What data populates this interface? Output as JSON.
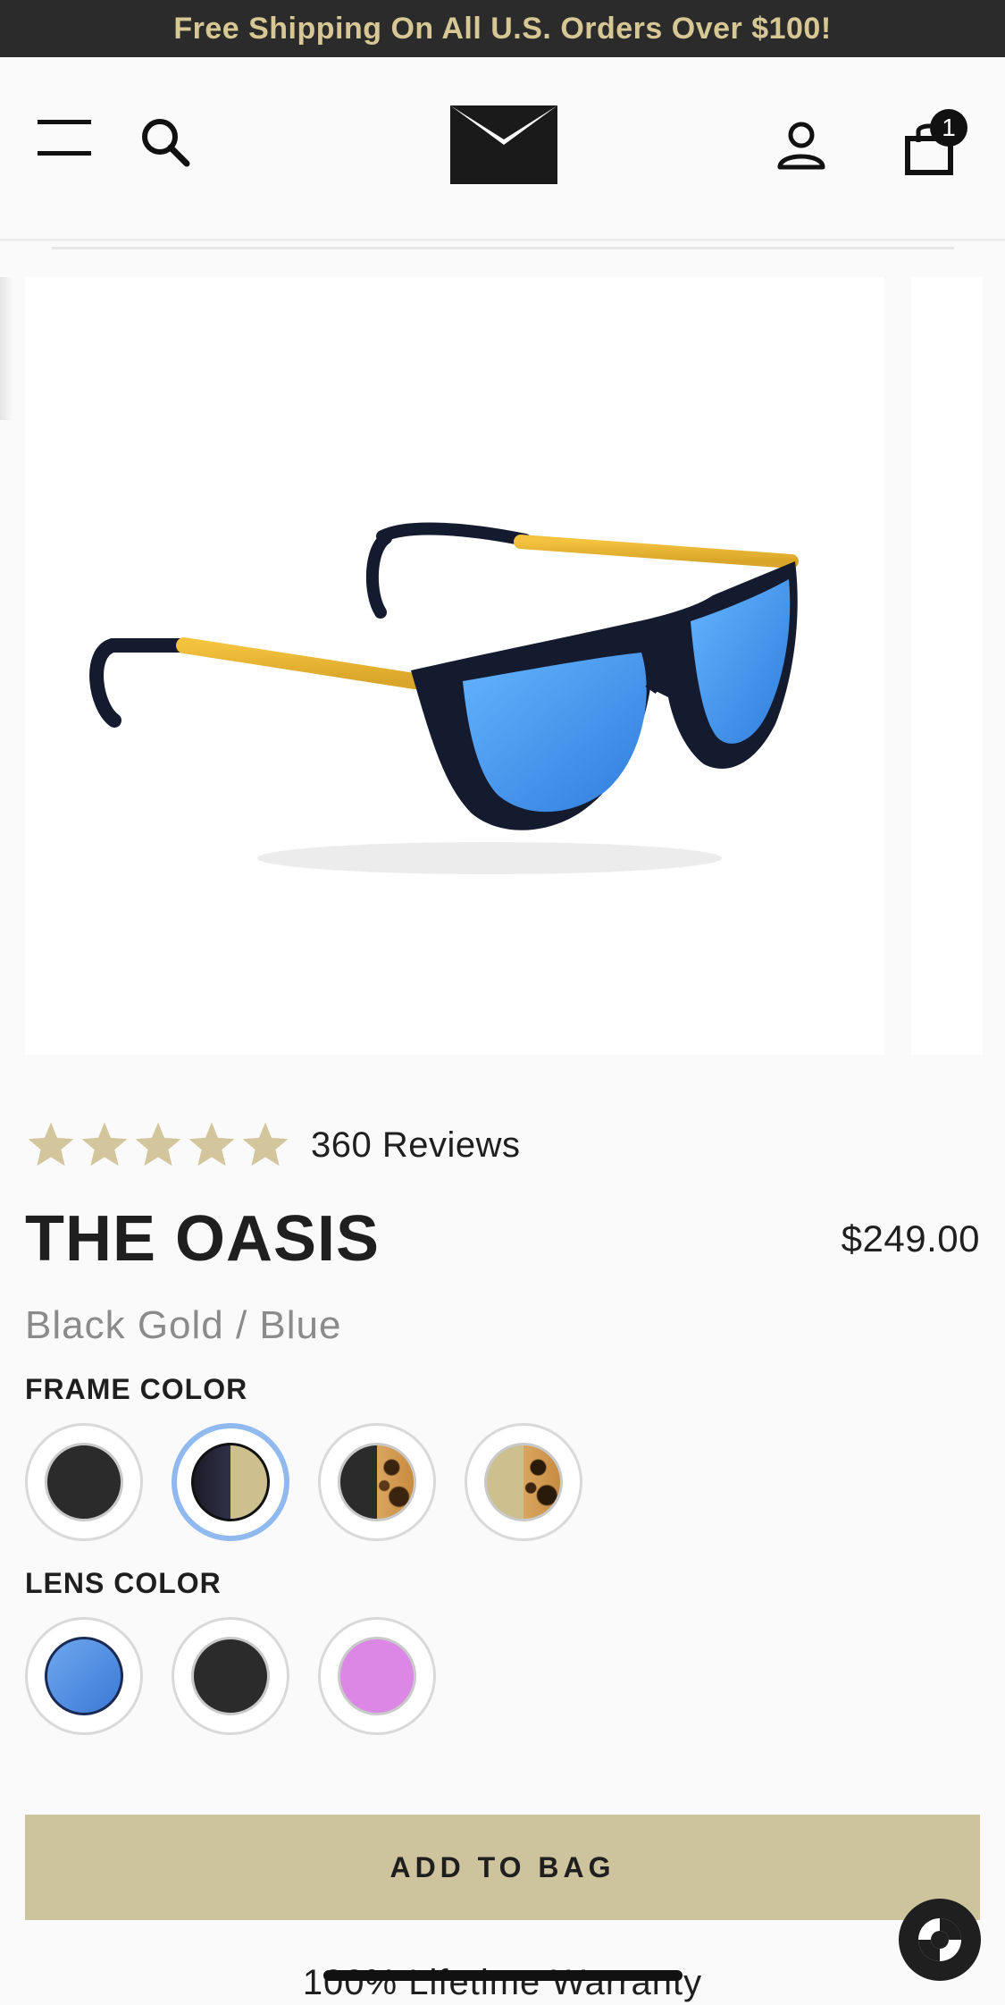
{
  "promo": {
    "text": "Free Shipping On All U.S. Orders Over $100!"
  },
  "header": {
    "bag_count": "1",
    "icons": [
      "menu-icon",
      "search-icon",
      "brand-logo",
      "account-icon",
      "shopping-bag-icon"
    ]
  },
  "gallery": {
    "current_image": "black-gold-blue-sunglasses"
  },
  "product": {
    "rating_stars": 5,
    "reviews_label": "360 Reviews",
    "title": "THE OASIS",
    "price": "$249.00",
    "variant": "Black Gold / Blue"
  },
  "options": {
    "frame_label": "FRAME COLOR",
    "frame_colors": [
      "black",
      "black-gold",
      "black-tortoise",
      "gold-tortoise"
    ],
    "frame_selected_index": 1,
    "lens_label": "LENS COLOR",
    "lens_colors": [
      "blue",
      "black",
      "pink"
    ],
    "lens_selected_index": 0
  },
  "actions": {
    "add_to_bag": "ADD TO BAG",
    "warranty": "100% Lifetime Warranty"
  },
  "colors": {
    "promo_bg": "#2b2b2b",
    "promo_text": "#d6c794",
    "accent_gold": "#cdc39c",
    "star_color": "#d3c69c",
    "selected_ring": "#8fb9ef",
    "lens_blue": "#4a8fe0",
    "lens_pink": "#dc86e6"
  }
}
